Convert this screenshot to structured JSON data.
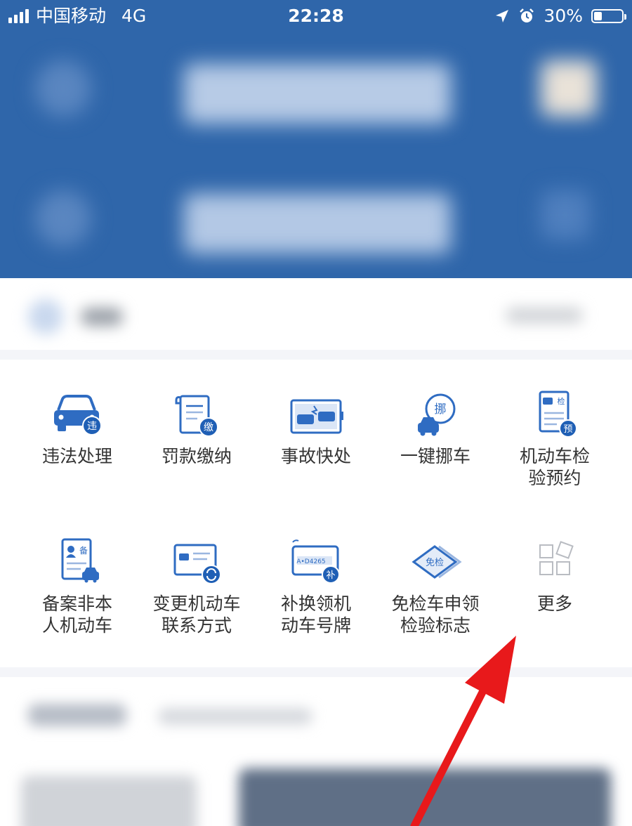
{
  "status_bar": {
    "carrier": "中国移动",
    "network": "4G",
    "time": "22:28",
    "battery_percent": "30%",
    "battery_level": 0.3,
    "icons": [
      "signal-icon",
      "location-icon",
      "alarm-icon",
      "battery-icon"
    ]
  },
  "colors": {
    "header_blue": "#2f66aa",
    "icon_blue": "#2f6cc2",
    "label_text": "#333333",
    "annotation_red": "#e8191b"
  },
  "services": [
    {
      "label": "违法处理",
      "badge": "违",
      "icon": "car-violation-icon"
    },
    {
      "label": "罚款缴纳",
      "badge": "缴",
      "icon": "fine-payment-icon"
    },
    {
      "label": "事故快处",
      "badge": "",
      "icon": "accident-icon"
    },
    {
      "label": "一键挪车",
      "badge": "挪",
      "icon": "move-car-icon"
    },
    {
      "label": "机动车检\n验预约",
      "badge": "检",
      "badge2": "预",
      "icon": "inspection-booking-icon"
    },
    {
      "label": "备案非本\n人机动车",
      "badge": "备",
      "icon": "vehicle-registration-icon"
    },
    {
      "label": "变更机动车\n联系方式",
      "badge": "",
      "icon": "contact-change-icon"
    },
    {
      "label": "补换领机\n动车号牌",
      "badge": "补",
      "plate_text": "A•D4265",
      "icon": "license-plate-icon"
    },
    {
      "label": "免检车申领\n检验标志",
      "badge": "免检",
      "icon": "inspection-exempt-icon"
    },
    {
      "label": "更多",
      "badge": "",
      "icon": "more-grid-icon"
    }
  ]
}
